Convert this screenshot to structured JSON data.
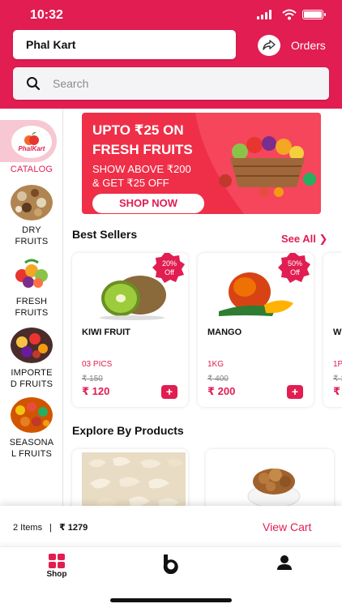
{
  "status_bar": {
    "time": "10:32"
  },
  "header": {
    "store_name": "Phal Kart",
    "orders_label": "Orders",
    "search_placeholder": "Search"
  },
  "sidebar": {
    "logo_text": "PhalKart",
    "items": [
      {
        "label": "CATALOG",
        "active": true
      },
      {
        "label": "DRY\nFRUITS",
        "active": false
      },
      {
        "label": "FRESH\nFRUITS",
        "active": false
      },
      {
        "label": "IMPORTE\nD FRUITS",
        "active": false
      },
      {
        "label": "SEASONA\nL FRUITS",
        "active": false
      }
    ]
  },
  "banner": {
    "line1": "UPTO ₹25 ON",
    "line2": "FRESH FRUITS",
    "line3": "SHOW ABOVE ₹200",
    "line4": "& GET ₹25 OFF",
    "cta": "SHOP NOW"
  },
  "best_sellers": {
    "title": "Best Sellers",
    "see_all": "See All",
    "items": [
      {
        "name": "KIWI FRUIT",
        "qty": "03 PICS",
        "old_price": "₹ 150",
        "price": "₹ 120",
        "badge_pct": "20%",
        "badge_off": "Off"
      },
      {
        "name": "MANGO",
        "qty": "1KG",
        "old_price": "₹ 400",
        "price": "₹ 200",
        "badge_pct": "50%",
        "badge_off": "Off"
      },
      {
        "name": "W",
        "qty": "1P",
        "old_price": "₹ 1",
        "price": "₹",
        "badge_pct": "",
        "badge_off": ""
      }
    ],
    "add_label": "+"
  },
  "explore": {
    "title": "Explore By Products"
  },
  "cart": {
    "items_text": "2 Items",
    "separator": "|",
    "total": "₹ 1279",
    "view_cart": "View Cart"
  },
  "tabbar": {
    "tabs": [
      {
        "label": "Shop"
      },
      {
        "label": ""
      },
      {
        "label": ""
      }
    ]
  },
  "colors": {
    "brand": "#e11d52",
    "banner": "#ef2f48"
  }
}
